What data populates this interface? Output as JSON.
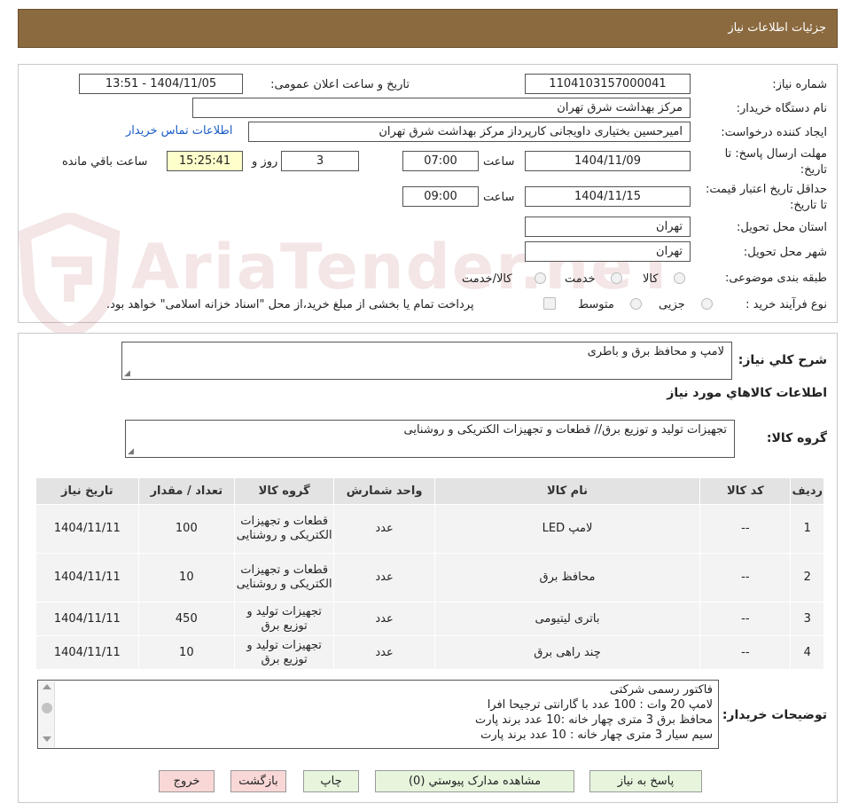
{
  "header": {
    "title": "جزئیات اطلاعات نیاز"
  },
  "fields": {
    "need_number_label": "شماره نیاز:",
    "need_number": "1104103157000041",
    "announce_label": "تاریخ و ساعت اعلان عمومی:",
    "announce_value": "1404/11/05 - 13:51",
    "buyer_label": "نام دستگاه خریدار:",
    "buyer_value": "مرکز بهداشت شرق تهران",
    "creator_label": "ایجاد کننده درخواست:",
    "creator_value": "امیرحسین بختیاری داویجانی کارپرداز مرکز بهداشت شرق تهران",
    "contact_link": "اطلاعات تماس خریدار",
    "deadline_label": "مهلت ارسال پاسخ: تا تاریخ:",
    "deadline_date": "1404/11/09",
    "time_label": "ساعت",
    "deadline_time": "07:00",
    "days_value": "3",
    "days_label": "روز و",
    "remaining_time": "15:25:41",
    "remaining_label": "ساعت باقي مانده",
    "validity_label": "حداقل تاریخ اعتبار قیمت: تا تاریخ:",
    "validity_date": "1404/11/15",
    "validity_time": "09:00",
    "province_label": "استان محل تحویل:",
    "province_value": "تهران",
    "city_label": "شهر محل تحویل:",
    "city_value": "تهران",
    "category_label": "طبقه بندی موضوعی:",
    "category_options": [
      "کالا",
      "خدمت",
      "کالا/خدمت"
    ],
    "process_label": "نوع فرآیند خرید :",
    "process_options": [
      "جزیی",
      "متوسط"
    ],
    "payment_note": "پرداخت تمام یا بخشی از مبلغ خرید،از محل \"اسناد خزانه اسلامی\" خواهد بود."
  },
  "summary": {
    "general_label": "شرح کلي نیاز:",
    "general_value": "لامپ و محافظ برق و باطری",
    "goods_info_title": "اطلاعات کالاهاي مورد نیاز",
    "group_label": "گروه کالا:",
    "group_value": "تجهیزات تولید و توزیع برق// قطعات و تجهیزات الکتریکی و روشنایی"
  },
  "table": {
    "headers": [
      "ردیف",
      "کد کالا",
      "نام کالا",
      "واحد شمارش",
      "گروه کالا",
      "تعداد / مقدار",
      "تاریخ نیاز"
    ],
    "rows": [
      [
        "1",
        "--",
        "لامپ LED",
        "عدد",
        "قطعات و تجهیزات الکتریکی و روشنایی",
        "100",
        "1404/11/11"
      ],
      [
        "2",
        "--",
        "محافظ برق",
        "عدد",
        "قطعات و تجهیزات الکتریکی و روشنایی",
        "10",
        "1404/11/11"
      ],
      [
        "3",
        "--",
        "باتری لیتیومی",
        "عدد",
        "تجهیزات تولید و توزیع برق",
        "450",
        "1404/11/11"
      ],
      [
        "4",
        "--",
        "چند راهی برق",
        "عدد",
        "تجهیزات تولید و توزیع برق",
        "10",
        "1404/11/11"
      ]
    ]
  },
  "notes": {
    "label": "توضیحات خریدار:",
    "lines": [
      "فاکتور رسمی شرکتی",
      "لامپ 20 وات : 100 عدد با گارانتی ترجیحا افرا",
      "محافظ برق 3 متری چهار خانه :10 عدد برند پارت",
      "سیم سیار 3 متری چهار خانه : 10 عدد برند پارت"
    ]
  },
  "buttons": {
    "reply": "پاسخ به نیاز",
    "attachments": "مشاهده مدارک پیوستي (0)",
    "print": "چاپ",
    "back": "بازگشت",
    "exit": "خروج"
  },
  "watermark": {
    "text": "AriaTender.neT"
  },
  "colors": {
    "header": "#8b6a3f",
    "link": "#1a5cc8",
    "yellow": "#ffffcc",
    "green_btn": "#e6f5dc",
    "pink_btn": "#f9d7d7"
  }
}
